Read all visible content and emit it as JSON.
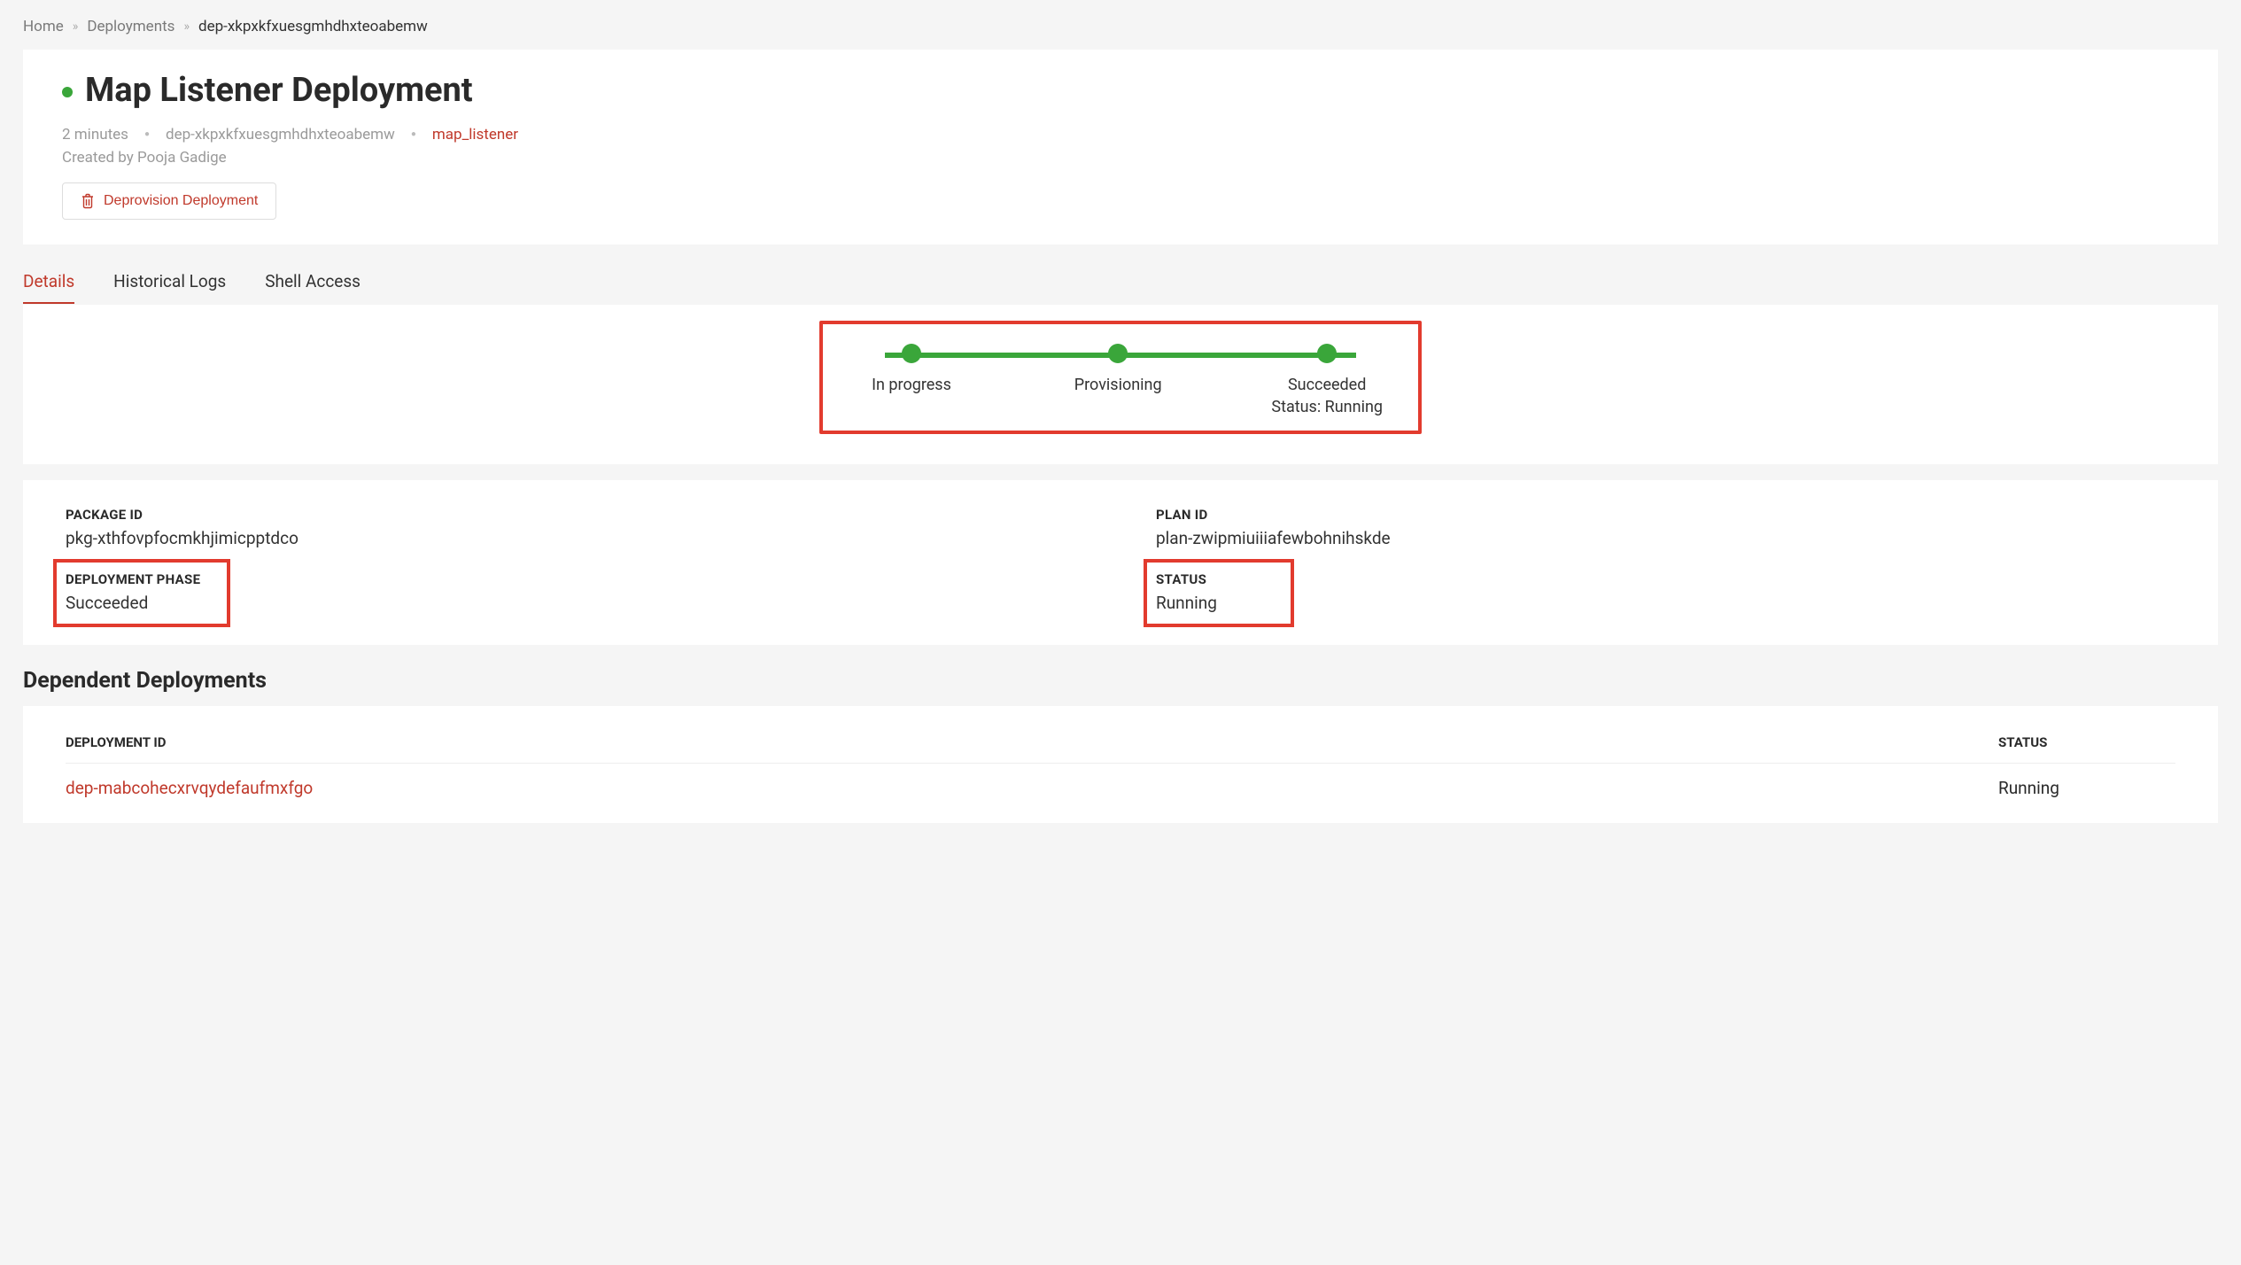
{
  "breadcrumb": {
    "home": "Home",
    "deployments": "Deployments",
    "current": "dep-xkpxkfxuesgmhdhxteoabemw"
  },
  "header": {
    "title": "Map Listener Deployment",
    "age": "2 minutes",
    "deployment_id": "dep-xkpxkfxuesgmhdhxteoabemw",
    "service_link": "map_listener",
    "created_by": "Created by Pooja Gadige",
    "deprovision_label": "Deprovision Deployment"
  },
  "tabs": {
    "details": "Details",
    "historical_logs": "Historical Logs",
    "shell_access": "Shell Access"
  },
  "progress": {
    "steps": [
      {
        "label": "In progress"
      },
      {
        "label": "Provisioning"
      },
      {
        "label": "Succeeded",
        "sub": "Status: Running"
      }
    ]
  },
  "details": {
    "package_id_label": "PACKAGE ID",
    "package_id_value": "pkg-xthfovpfocmkhjimicpptdco",
    "plan_id_label": "PLAN ID",
    "plan_id_value": "plan-zwipmiuiiiafewbohnihskde",
    "deployment_phase_label": "DEPLOYMENT PHASE",
    "deployment_phase_value": "Succeeded",
    "status_label": "STATUS",
    "status_value": "Running"
  },
  "dependent": {
    "section_title": "Dependent Deployments",
    "columns": {
      "id": "DEPLOYMENT ID",
      "status": "STATUS"
    },
    "rows": [
      {
        "id": "dep-mabcohecxrvqydefaufmxfgo",
        "status": "Running"
      }
    ]
  }
}
